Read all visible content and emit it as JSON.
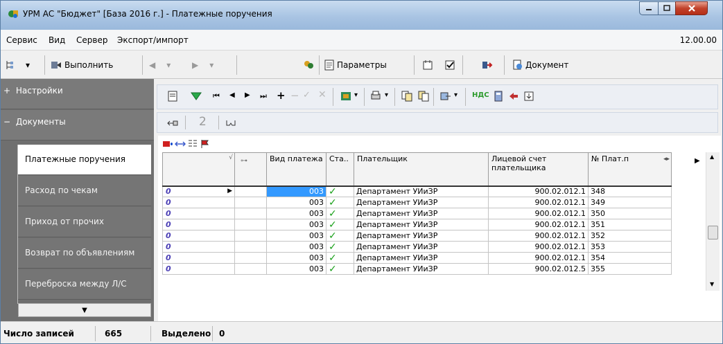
{
  "window": {
    "title": "УРМ АС \"Бюджет\" [База 2016 г.] - Платежные поручения"
  },
  "menu": {
    "items": [
      "Сервис",
      "Вид",
      "Сервер",
      "Экспорт/импорт"
    ],
    "version": "12.00.00"
  },
  "toolbar": {
    "run_label": "Выполнить",
    "params_label": "Параметры",
    "document_label": "Документ"
  },
  "sidebar": {
    "settings_label": "Настройки",
    "docs_label": "Документы",
    "items": [
      "Платежные поручения",
      "Расход по чекам",
      "Приход от прочих",
      "Возврат по объявлениям",
      "Переброска между Л/С"
    ]
  },
  "content_toolbar": {
    "nds_label": "НДС",
    "counter": "2"
  },
  "grid": {
    "columns": [
      "",
      "",
      "Вид платежа",
      "Ста..",
      "Плательщик",
      "Лицевой счет плательщика",
      "№ Плат.п"
    ],
    "rows": [
      {
        "lead": "0",
        "vid": "003",
        "payer": "Департамент УИиЗР",
        "account": "900.02.012.1",
        "num": "348"
      },
      {
        "lead": "0",
        "vid": "003",
        "payer": "Департамент УИиЗР",
        "account": "900.02.012.1",
        "num": "349"
      },
      {
        "lead": "0",
        "vid": "003",
        "payer": "Департамент УИиЗР",
        "account": "900.02.012.1",
        "num": "350"
      },
      {
        "lead": "0",
        "vid": "003",
        "payer": "Департамент УИиЗР",
        "account": "900.02.012.1",
        "num": "351"
      },
      {
        "lead": "0",
        "vid": "003",
        "payer": "Департамент УИиЗР",
        "account": "900.02.012.1",
        "num": "352"
      },
      {
        "lead": "0",
        "vid": "003",
        "payer": "Департамент УИиЗР",
        "account": "900.02.012.1",
        "num": "353"
      },
      {
        "lead": "0",
        "vid": "003",
        "payer": "Департамент УИиЗР",
        "account": "900.02.012.1",
        "num": "354"
      },
      {
        "lead": "0",
        "vid": "003",
        "payer": "Департамент УИиЗР",
        "account": "900.02.012.5",
        "num": "355"
      }
    ]
  },
  "status": {
    "records_label": "Число записей",
    "records_value": "665",
    "selected_label": "Выделено",
    "selected_value": "0"
  }
}
